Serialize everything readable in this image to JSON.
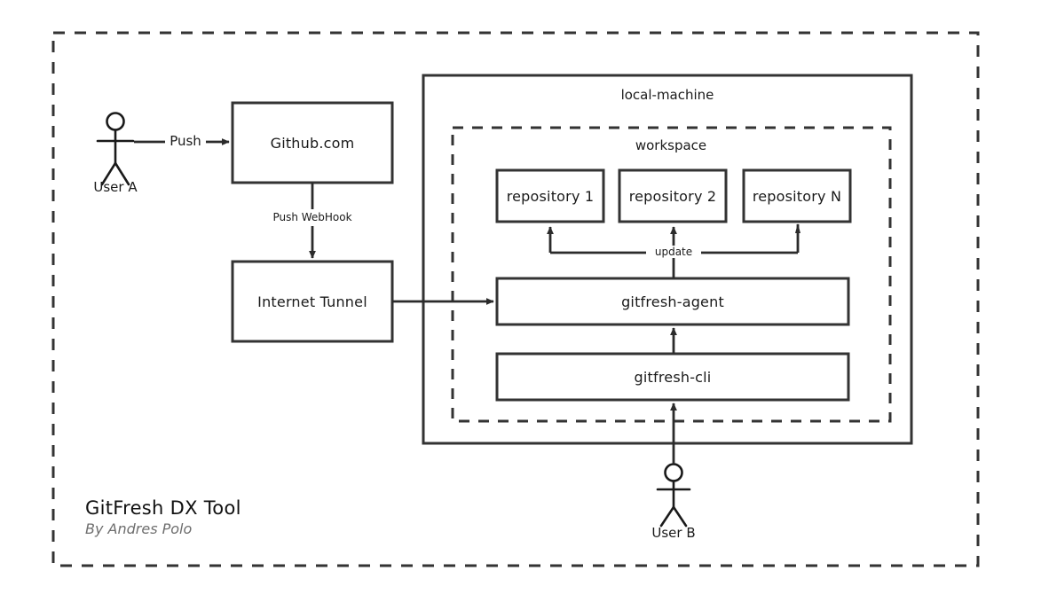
{
  "diagram": {
    "title": "GitFresh DX Tool",
    "subtitle": "By Andres Polo",
    "outer_boundary_name": "GitFresh DX Tool boundary",
    "stroke_color": "#333333",
    "text_color": "#1a1a1a",
    "subtitle_color": "#6e6e6e",
    "background": "#ffffff"
  },
  "actors": [
    {
      "id": "user_a",
      "label": "User A"
    },
    {
      "id": "user_b",
      "label": "User B"
    }
  ],
  "groups": [
    {
      "id": "local_machine",
      "label": "local-machine",
      "border": "solid"
    },
    {
      "id": "workspace",
      "label": "workspace",
      "border": "dashed"
    }
  ],
  "nodes": [
    {
      "id": "github",
      "label": "Github.com"
    },
    {
      "id": "internet_tunnel",
      "label": "Internet Tunnel"
    },
    {
      "id": "repository_1",
      "label": "repository 1"
    },
    {
      "id": "repository_2",
      "label": "repository 2"
    },
    {
      "id": "repository_n",
      "label": "repository N"
    },
    {
      "id": "gitfresh_agent",
      "label": "gitfresh-agent"
    },
    {
      "id": "gitfresh_cli",
      "label": "gitfresh-cli"
    }
  ],
  "edges": [
    {
      "id": "push",
      "label": "Push",
      "from": "user_a",
      "to": "github"
    },
    {
      "id": "push_webhook",
      "label": "Push WebHook",
      "from": "github",
      "to": "internet_tunnel"
    },
    {
      "id": "tunnel_to_agent",
      "label": "",
      "from": "internet_tunnel",
      "to": "gitfresh_agent"
    },
    {
      "id": "update",
      "label": "update",
      "from": "gitfresh_agent",
      "to": "repositories"
    },
    {
      "id": "cli_to_agent",
      "label": "",
      "from": "gitfresh_cli",
      "to": "gitfresh_agent"
    },
    {
      "id": "userb_to_cli",
      "label": "",
      "from": "user_b",
      "to": "gitfresh_cli"
    }
  ]
}
